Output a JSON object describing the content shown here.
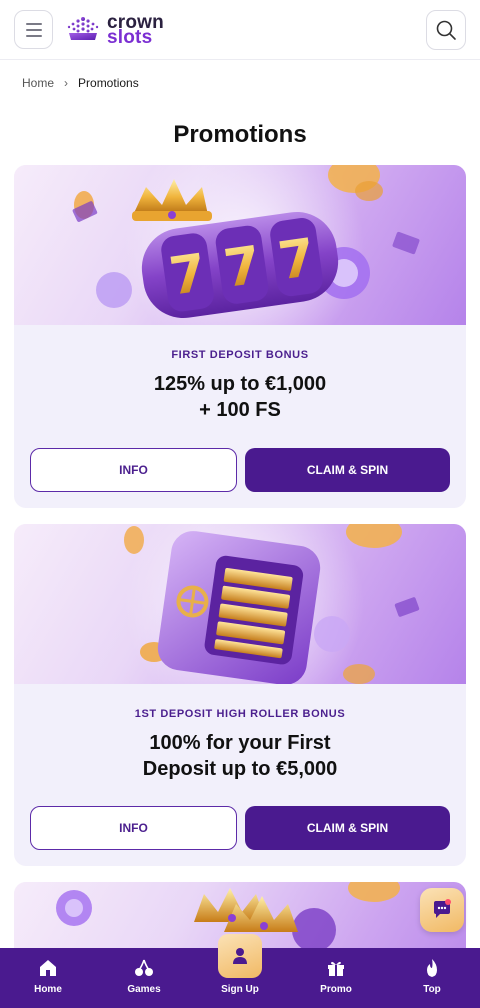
{
  "header": {
    "logo_line1": "crown",
    "logo_line2": "slots"
  },
  "breadcrumb": {
    "home": "Home",
    "separator": "›",
    "current": "Promotions"
  },
  "page_title": "Promotions",
  "promotions": [
    {
      "tag": "FIRST DEPOSIT BONUS",
      "title_line1": "125% up to €1,000",
      "title_line2": "+ 100 FS",
      "info_label": "INFO",
      "claim_label": "CLAIM & SPIN"
    },
    {
      "tag": "1ST DEPOSIT HIGH ROLLER BONUS",
      "title_line1": "100% for your First",
      "title_line2": "Deposit up to €5,000",
      "info_label": "INFO",
      "claim_label": "CLAIM & SPIN"
    }
  ],
  "bottom_nav": [
    {
      "label": "Home",
      "icon": "home-icon"
    },
    {
      "label": "Games",
      "icon": "cherry-icon"
    },
    {
      "label": "Sign Up",
      "icon": "user-icon"
    },
    {
      "label": "Promo",
      "icon": "gift-icon"
    },
    {
      "label": "Top",
      "icon": "flame-icon"
    }
  ],
  "colors": {
    "brand_purple": "#4a1a8f",
    "accent_gold": "#f1b964",
    "card_bg": "#f2f0fb"
  }
}
